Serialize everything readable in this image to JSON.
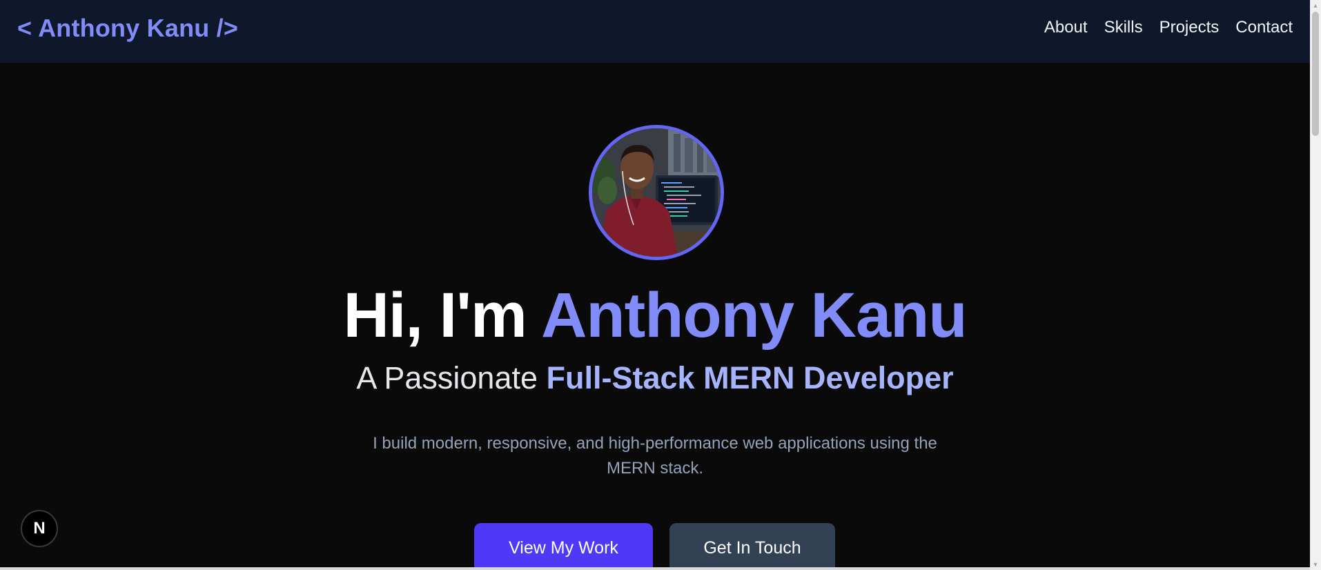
{
  "header": {
    "logo": "< Anthony Kanu />",
    "nav": [
      "About",
      "Skills",
      "Projects",
      "Contact"
    ]
  },
  "hero": {
    "greeting": "Hi, I'm ",
    "name": "Anthony Kanu",
    "subtitle_prefix": "A Passionate ",
    "subtitle_highlight": "Full-Stack MERN Developer",
    "description": "I build modern, responsive, and high-performance web applications using the MERN stack.",
    "primary_button": "View My Work",
    "secondary_button": "Get In Touch"
  },
  "dev_indicator": {
    "label": "N"
  },
  "colors": {
    "accent": "#818cf8",
    "header_bg": "#0f172a",
    "page_bg": "#0a0a0a",
    "primary_button": "#4f39f6",
    "secondary_button": "#334155",
    "avatar_ring": "#6366f1"
  }
}
